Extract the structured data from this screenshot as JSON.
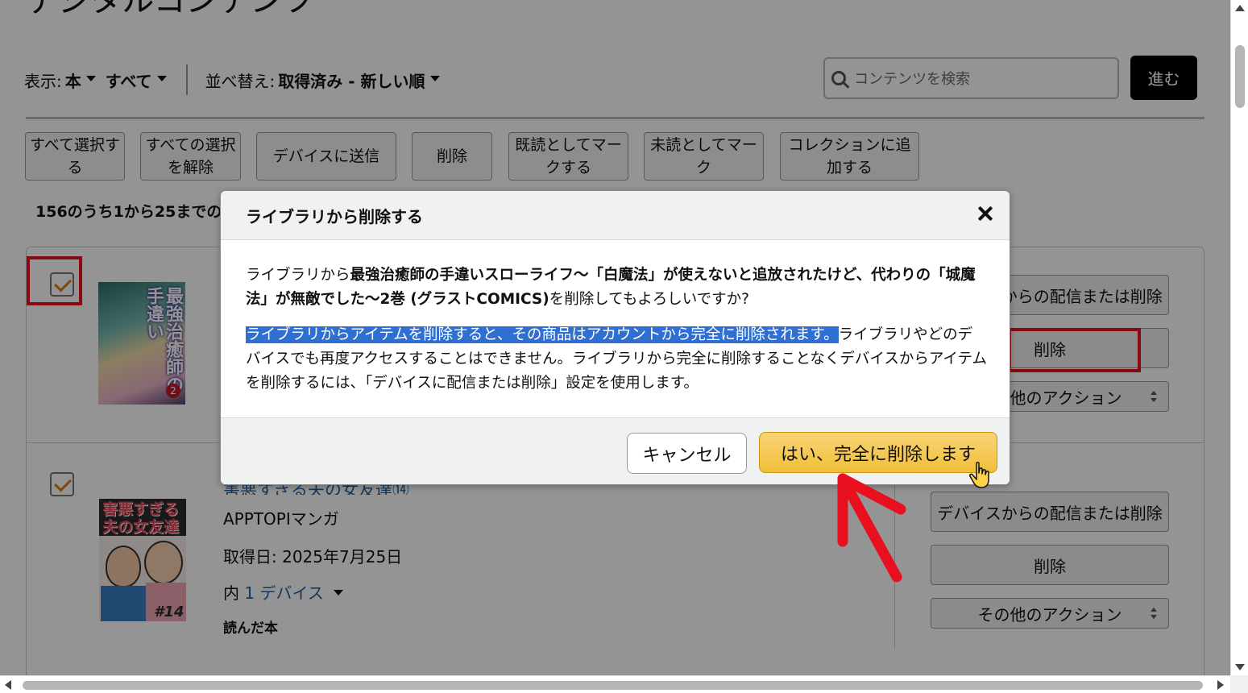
{
  "page": {
    "title": "デジタルコンテンツ"
  },
  "filters": {
    "show_label": "表示:",
    "show_value": "本",
    "scope_value": "すべて",
    "sort_label": "並べ替え:",
    "sort_value": "取得済み - 新しい順"
  },
  "search": {
    "placeholder": "コンテンツを検索",
    "go_label": "進む"
  },
  "actions": {
    "select_all": "すべて選択する",
    "deselect_all": "すべての選択を解除",
    "send_to_device": "デバイスに送信",
    "delete": "削除",
    "mark_read": "既読としてマークする",
    "mark_unread": "未読としてマーク",
    "add_to_collection": "コレクションに追加する"
  },
  "list": {
    "count_text": "156のうち1から25までの",
    "items": [
      {
        "side_actions": {
          "deliver_or_remove": "デバイスからの配信または削除",
          "delete": "削除",
          "more_actions": "その他のアクション"
        }
      },
      {
        "title": "害悪すぎる夫の女友達⑭",
        "publisher": "APPTOPIマンガ",
        "acquired": "取得日: 2025年7月25日",
        "devices_prefix": "内",
        "devices_link": "1 デバイス",
        "read_status": "読んだ本",
        "cover_text": "害悪すぎる夫の女友達",
        "cover_num": "#14",
        "side_actions": {
          "deliver_or_remove": "デバイスからの配信または削除",
          "delete": "削除",
          "more_actions": "その他のアクション"
        }
      }
    ],
    "cover1_text": "最強治癒師の手違い",
    "cover1_vol": "2"
  },
  "modal": {
    "title": "ライブラリから削除する",
    "line1_prefix": "ライブラリから",
    "line1_bold": "最強治癒師の手違いスローライフ〜「白魔法」が使えないと追放されたけど、代わりの「城魔法」が無敵でした〜2巻 (グラストCOMICS)",
    "line1_suffix": "を削除してもよろしいですか?",
    "warning_highlight": "ライブラリからアイテムを削除すると、その商品はアカウントから完全に削除されます。",
    "warning_rest": "ライブラリやどのデバイスでも再度アクセスすることはできません。ライブラリから完全に削除することなくデバイスからアイテムを削除するには、「デバイスに配信または削除」設定を使用します。",
    "cancel_label": "キャンセル",
    "confirm_label": "はい、完全に削除します"
  },
  "colors": {
    "overlay": "rgba(0,0,0,0.42)",
    "highlight": "#2f6fd1",
    "confirm_button": "#f1bf38",
    "annotation_red": "#e8101f",
    "checkmark": "#e47911",
    "link": "#2162a1"
  },
  "icons": [
    "search-icon",
    "close-icon",
    "checkbox-checked-icon",
    "caret-down-icon",
    "hand-cursor-icon",
    "annotation-arrow-icon"
  ]
}
